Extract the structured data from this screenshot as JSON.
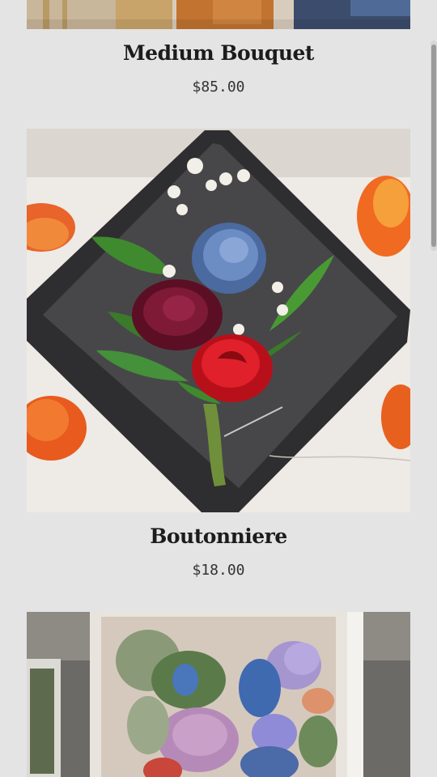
{
  "products": [
    {
      "name": "Medium Bouquet",
      "price": "$85.00",
      "image": "medium-bouquet-photo"
    },
    {
      "name": "Boutonniere",
      "price": "$18.00",
      "image": "boutonniere-photo"
    },
    {
      "name": "",
      "price": "",
      "image": "flower-box-photo"
    }
  ],
  "colors": {
    "background": "#e4e4e4",
    "title": "#1c1c1c",
    "price": "#333333"
  }
}
